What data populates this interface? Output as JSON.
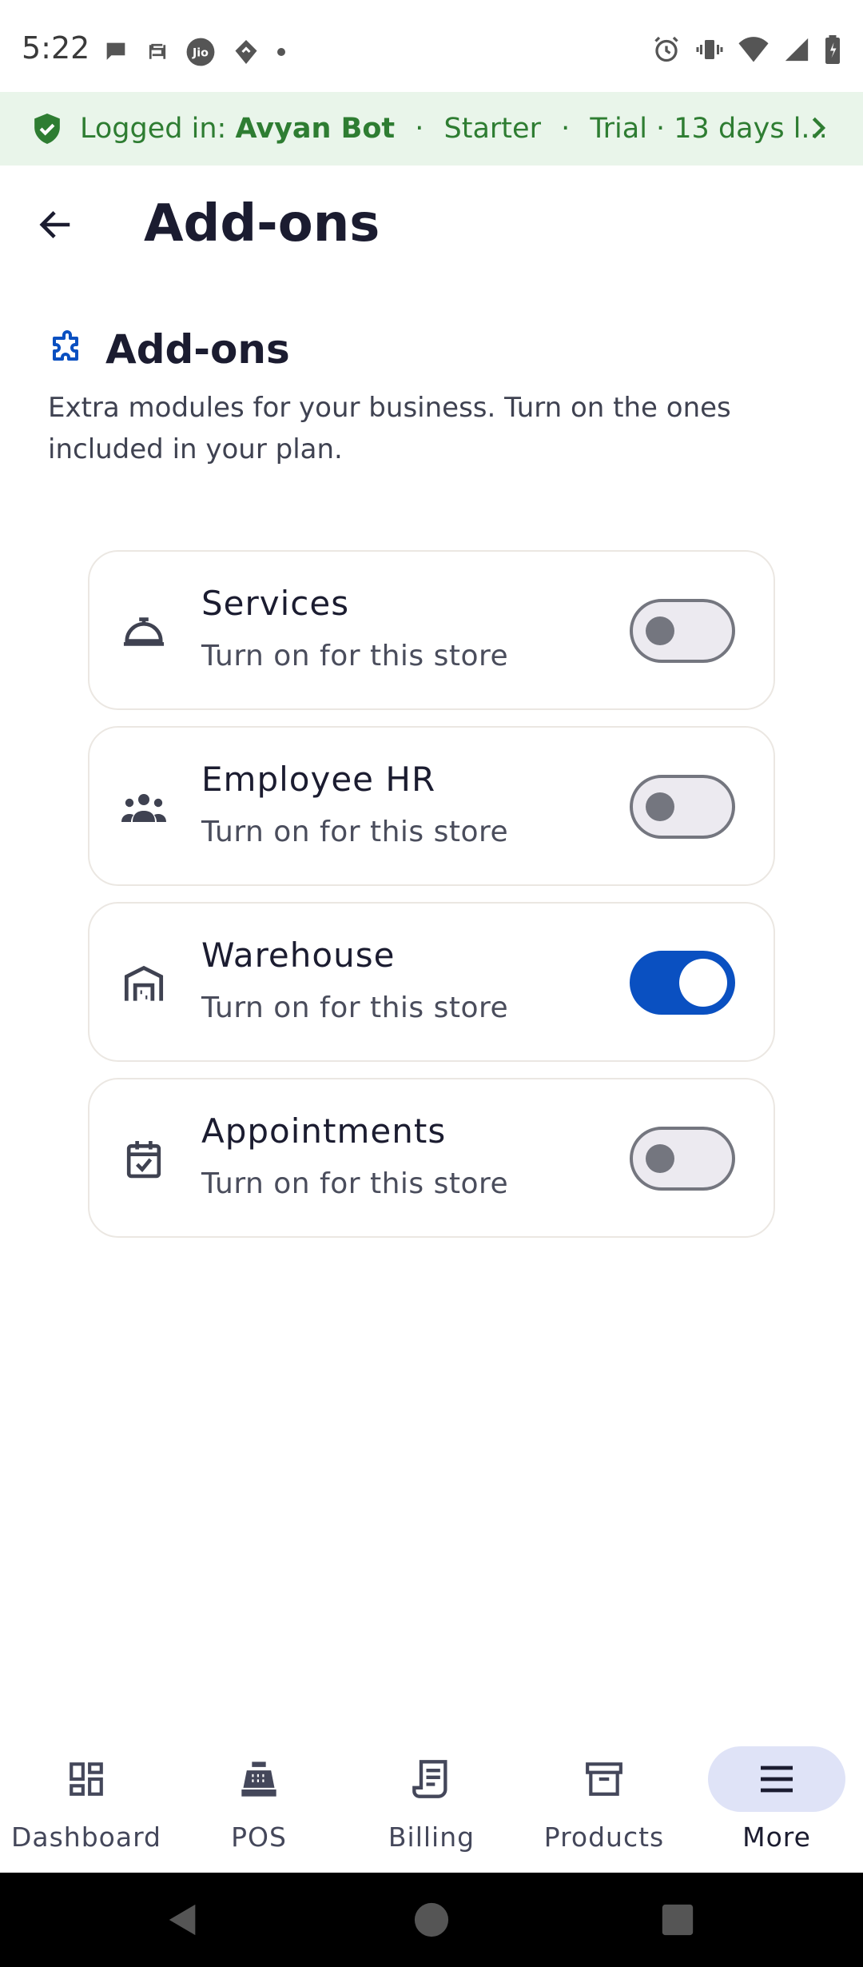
{
  "status_bar": {
    "time": "5:22",
    "left_icons": [
      "chat-bubble-icon",
      "s-app-icon",
      "jio-icon",
      "maps-pin-icon",
      "dot-icon"
    ],
    "right_icons": [
      "alarm-icon",
      "vibrate-icon",
      "wifi-icon",
      "signal-icon",
      "battery-icon"
    ]
  },
  "login_banner": {
    "prefix": "Logged in:",
    "user": "Avyan Bot",
    "separator": "·",
    "plan": "Starter",
    "trial": "Trial · 13 days l...",
    "icon": "verified-shield-icon",
    "color": "#2e7d32"
  },
  "app_bar": {
    "title": "Add-ons",
    "back_icon": "arrow-left-icon"
  },
  "section": {
    "title": "Add-ons",
    "icon": "puzzle-icon",
    "description": "Extra modules for your business. Turn on the ones included in your plan."
  },
  "addons": [
    {
      "title": "Services",
      "subtitle": "Turn on for this store",
      "icon": "service-bell-icon",
      "enabled": false
    },
    {
      "title": "Employee HR",
      "subtitle": "Turn on for this store",
      "icon": "group-icon",
      "enabled": false
    },
    {
      "title": "Warehouse",
      "subtitle": "Turn on for this store",
      "icon": "warehouse-icon",
      "enabled": true
    },
    {
      "title": "Appointments",
      "subtitle": "Turn on for this store",
      "icon": "calendar-check-icon",
      "enabled": false
    }
  ],
  "bottom_nav": [
    {
      "label": "Dashboard",
      "icon": "dashboard-icon",
      "active": false
    },
    {
      "label": "POS",
      "icon": "cash-register-icon",
      "active": false
    },
    {
      "label": "Billing",
      "icon": "receipt-icon",
      "active": false
    },
    {
      "label": "Products",
      "icon": "archive-box-icon",
      "active": false
    },
    {
      "label": "More",
      "icon": "menu-icon",
      "active": true
    }
  ],
  "colors": {
    "accent": "#0a50c1",
    "banner_bg": "#e9f5ea",
    "nav_active_bg": "#dfe3f7",
    "card_border": "#ebe7e2"
  }
}
